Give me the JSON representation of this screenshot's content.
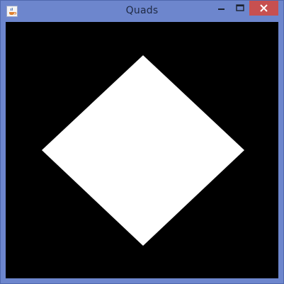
{
  "window": {
    "title": "Quads",
    "frame_color": "#6d86cd",
    "close_color": "#c75050",
    "icon": "java-coffee-cup-icon"
  },
  "titlebar_controls": [
    {
      "name": "minimize-button",
      "icon": "minimize-icon"
    },
    {
      "name": "maximize-button",
      "icon": "maximize-icon"
    },
    {
      "name": "close-button",
      "icon": "close-icon"
    }
  ],
  "canvas": {
    "background": "#000000",
    "shape_fill": "#ffffff",
    "shape": "diamond"
  }
}
